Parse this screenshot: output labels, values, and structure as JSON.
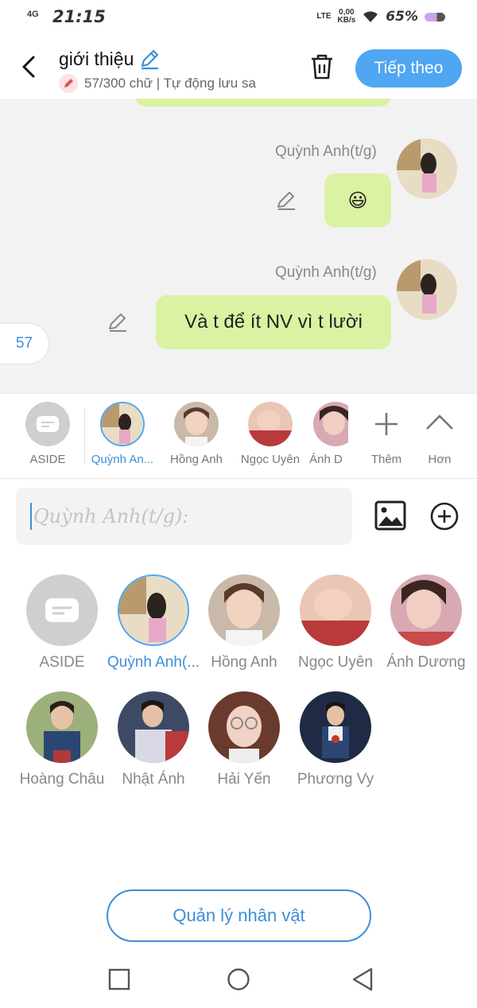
{
  "status_bar": {
    "network": "4G",
    "time": "21:15",
    "lte": "LTE",
    "speed_value": "0,00",
    "speed_unit": "KB/s",
    "battery_pct": "65%"
  },
  "header": {
    "title": "giới thiệu",
    "subtitle": "57/300 chữ | Tự động lưu sa",
    "next_label": "Tiếp theo"
  },
  "chat": {
    "messages": [
      {
        "sender": "Quỳnh Anh(t/g)",
        "text": "😃"
      },
      {
        "sender": "Quỳnh Anh(t/g)",
        "text": "Và t để ít NV vì t lười"
      }
    ],
    "count_badge": "57"
  },
  "strip": {
    "items": [
      {
        "label": "ASIDE"
      },
      {
        "label": "Quỳnh An..."
      },
      {
        "label": "Hồng Anh"
      },
      {
        "label": "Ngọc Uyên"
      },
      {
        "label": "Ánh D"
      }
    ],
    "more_label": "Thêm",
    "collapse_label": "Hơn"
  },
  "input": {
    "placeholder": "Quỳnh Anh(t/g):"
  },
  "grid": {
    "items": [
      {
        "label": "ASIDE"
      },
      {
        "label": "Quỳnh Anh(..."
      },
      {
        "label": "Hồng Anh"
      },
      {
        "label": "Ngọc Uyên"
      },
      {
        "label": "Ánh Dương"
      },
      {
        "label": "Hoàng Châu"
      },
      {
        "label": "Nhật Ánh"
      },
      {
        "label": "Hải Yến"
      },
      {
        "label": "Phương Vy"
      }
    ]
  },
  "manage_label": "Quản lý nhân vật",
  "colors": {
    "accent": "#4fa6f2",
    "bubble": "#dbf2a3",
    "chat_bg": "#f2f2f2"
  }
}
